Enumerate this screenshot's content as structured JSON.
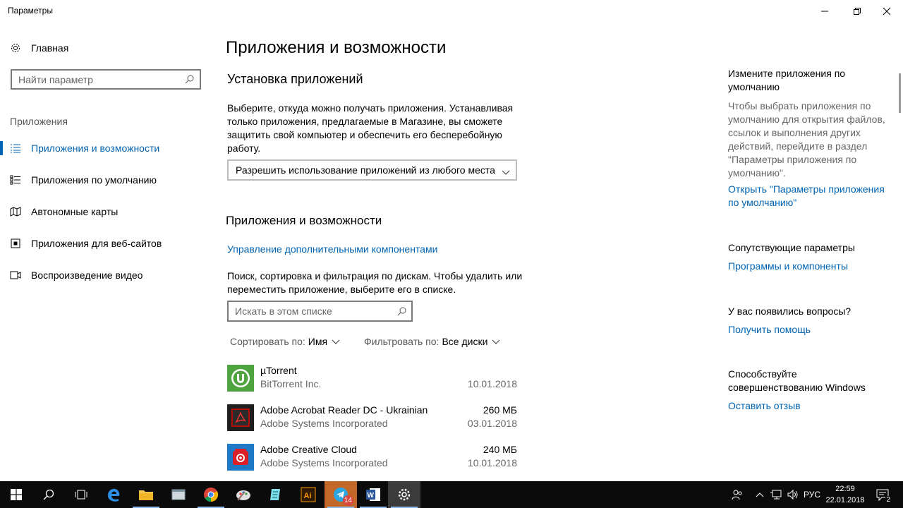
{
  "window": {
    "title": "Параметры"
  },
  "sidebar": {
    "home_label": "Главная",
    "search_placeholder": "Найти параметр",
    "section_label": "Приложения",
    "items": [
      {
        "label": "Приложения и возможности",
        "icon": "apps-list-icon",
        "active": true
      },
      {
        "label": "Приложения по умолчанию",
        "icon": "default-apps-icon",
        "active": false
      },
      {
        "label": "Автономные карты",
        "icon": "map-icon",
        "active": false
      },
      {
        "label": "Приложения для веб-сайтов",
        "icon": "web-apps-icon",
        "active": false
      },
      {
        "label": "Воспроизведение видео",
        "icon": "video-icon",
        "active": false
      }
    ]
  },
  "main": {
    "page_title": "Приложения и возможности",
    "install": {
      "heading": "Установка приложений",
      "description": "Выберите, откуда можно получать приложения. Устанавливая только приложения, предлагаемые в Магазине, вы сможете защитить свой компьютер и обеспечить его бесперебойную работу.",
      "dropdown_value": "Разрешить использование приложений из любого места"
    },
    "apps": {
      "heading": "Приложения и возможности",
      "manage_link": "Управление дополнительными компонентами",
      "description": "Поиск, сортировка и фильтрация по дискам. Чтобы удалить или переместить приложение, выберите его в списке.",
      "search_placeholder": "Искать в этом списке",
      "sort_label": "Сортировать по:",
      "sort_value": "Имя",
      "filter_label": "Фильтровать по:",
      "filter_value": "Все диски",
      "list": [
        {
          "name": "µTorrent",
          "publisher": "BitTorrent Inc.",
          "size": "",
          "date": "10.01.2018",
          "icon": "utorrent-icon",
          "color": "#4fa43f"
        },
        {
          "name": "Adobe Acrobat Reader DC - Ukrainian",
          "publisher": "Adobe Systems Incorporated",
          "size": "260 МБ",
          "date": "03.01.2018",
          "icon": "acrobat-icon",
          "color": "#b3100b"
        },
        {
          "name": "Adobe Creative Cloud",
          "publisher": "Adobe Systems Incorporated",
          "size": "240 МБ",
          "date": "10.01.2018",
          "icon": "creative-cloud-icon",
          "color": "#da1f26"
        }
      ]
    }
  },
  "right": {
    "default_apps": {
      "heading": "Измените приложения по умолчанию",
      "text": "Чтобы выбрать приложения по умолчанию для открытия файлов, ссылок и выполнения других действий, перейдите в раздел \"Параметры приложения по умолчанию\".",
      "link": "Открыть \"Параметры приложения по умолчанию\""
    },
    "related": {
      "heading": "Сопутствующие параметры",
      "link": "Программы и компоненты"
    },
    "questions": {
      "heading": "У вас появились вопросы?",
      "link": "Получить помощь"
    },
    "feedback": {
      "heading": "Способствуйте совершенствованию Windows",
      "link": "Оставить отзыв"
    }
  },
  "taskbar": {
    "telegram_badge": "14",
    "language": "РУС",
    "time": "22:59",
    "date": "22.01.2018",
    "notifications_count": "2"
  },
  "colors": {
    "accent": "#0063b1",
    "taskbar": "#0b0b0b"
  }
}
